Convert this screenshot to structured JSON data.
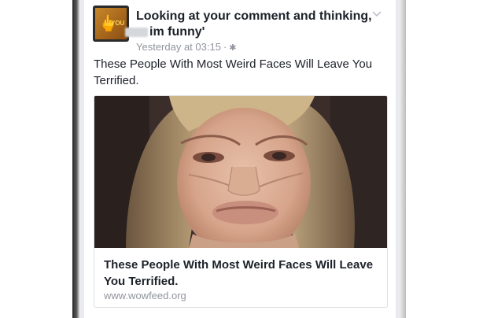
{
  "post": {
    "page_name_line1": "Looking at your comment and thinking,",
    "page_name_line2": "im funny'",
    "timestamp": "Yesterday at 03:15",
    "separator": "·",
    "privacy_icon": "gear-icon",
    "avatar_text": "YOU",
    "avatar_icon": "middle-finger-icon",
    "menu_icon": "chevron-down-icon",
    "text": "These People With Most Weird Faces Will Leave You Terrified."
  },
  "link_preview": {
    "image_icon": "face-photo",
    "title": "These People With Most Weird Faces Will Leave You Terrified.",
    "domain": "www.wowfeed.org"
  }
}
